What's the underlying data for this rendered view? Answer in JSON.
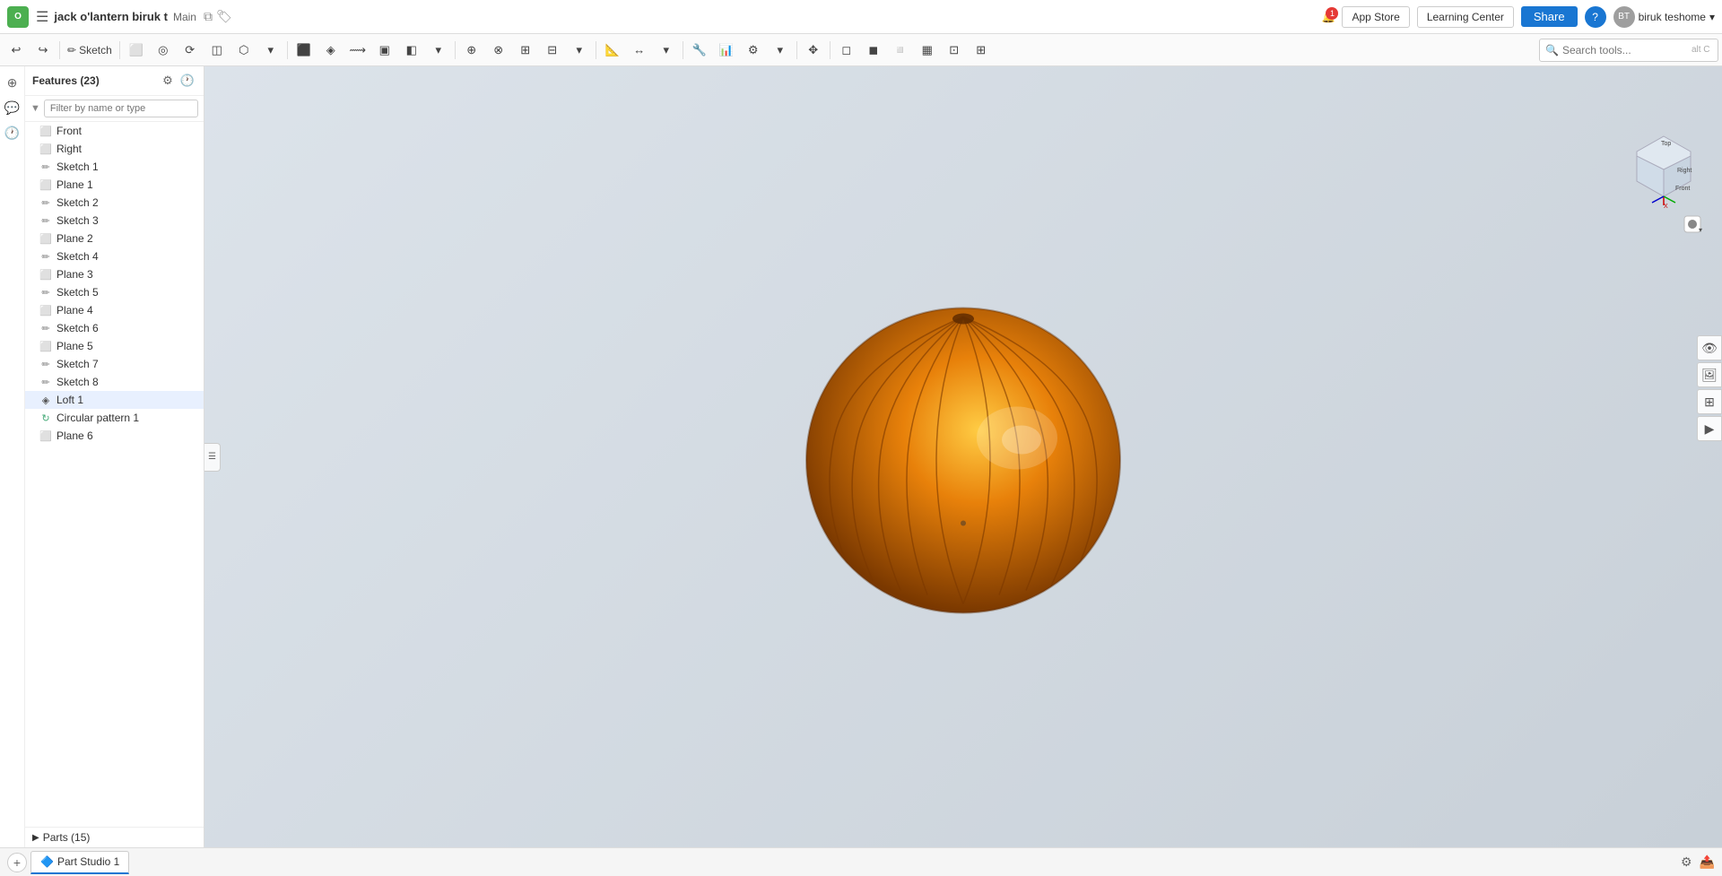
{
  "app": {
    "logo_text": "O",
    "doc_title": "jack o'lantern biruk t",
    "doc_branch": "Main",
    "notif_count": "1"
  },
  "topbar": {
    "app_store_label": "App Store",
    "learning_center_label": "Learning Center",
    "share_label": "Share",
    "help_label": "?",
    "user_name": "biruk teshome",
    "user_avatar": "BT"
  },
  "toolbar": {
    "undo_label": "↩",
    "redo_label": "↪",
    "sketch_label": "Sketch",
    "search_placeholder": "Search tools...",
    "search_hint": "alt C"
  },
  "sidebar": {
    "title": "Features (23)",
    "filter_placeholder": "Filter by name or type",
    "features": [
      {
        "name": "Front",
        "type": "plane"
      },
      {
        "name": "Right",
        "type": "plane"
      },
      {
        "name": "Sketch 1",
        "type": "sketch"
      },
      {
        "name": "Plane 1",
        "type": "plane"
      },
      {
        "name": "Sketch 2",
        "type": "sketch"
      },
      {
        "name": "Sketch 3",
        "type": "sketch"
      },
      {
        "name": "Plane 2",
        "type": "plane"
      },
      {
        "name": "Sketch 4",
        "type": "sketch"
      },
      {
        "name": "Plane 3",
        "type": "plane"
      },
      {
        "name": "Sketch 5",
        "type": "sketch"
      },
      {
        "name": "Plane 4",
        "type": "plane"
      },
      {
        "name": "Sketch 6",
        "type": "sketch"
      },
      {
        "name": "Plane 5",
        "type": "plane"
      },
      {
        "name": "Sketch 7",
        "type": "sketch"
      },
      {
        "name": "Sketch 8",
        "type": "sketch"
      },
      {
        "name": "Loft 1",
        "type": "loft"
      },
      {
        "name": "Circular pattern 1",
        "type": "circular"
      },
      {
        "name": "Plane 6",
        "type": "plane"
      }
    ],
    "parts_label": "Parts (15)"
  },
  "bottom": {
    "tab_label": "Part Studio 1",
    "tab_icon": "🔷"
  },
  "viewport": {
    "cube_top": "Top",
    "cube_front": "Front",
    "cube_right": "Right"
  }
}
